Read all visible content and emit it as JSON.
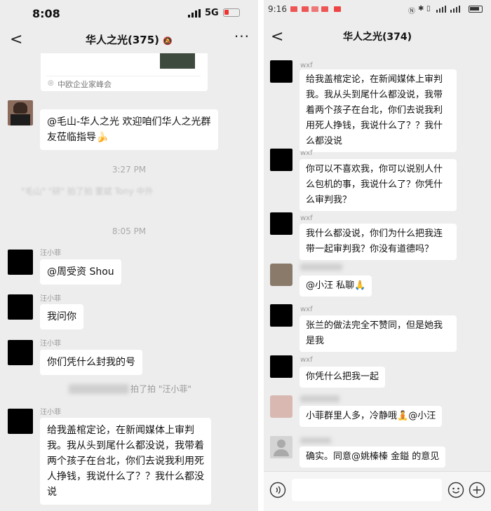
{
  "left": {
    "status": {
      "time": "8:08",
      "network": "5G"
    },
    "title": "华人之光(375)",
    "link_card_source": "中欧企业家峰会",
    "welcome_message": "@毛山-华人之光 欢迎咱们华人之光群友莅临指导",
    "welcome_emoji": "🍌",
    "time1": "3:27 PM",
    "blurred_line": "\"毛山\"  \"研\"   拍了拍 董斌 Tony 中外",
    "time2": "8:05 PM",
    "sender": "汪小菲",
    "msg1": "@周受资 Shou",
    "msg2": "我问你",
    "msg3": "你们凭什么封我的号",
    "pat_text": "拍了拍 \"汪小菲\"",
    "msg4": "给我盖棺定论，在新闻媒体上审判我。我从头到尾什么都没说，我带着两个孩子在台北，你们去说我利用死人挣钱，我说什么了？？我什么都没说"
  },
  "right": {
    "status": {
      "time": "9:16"
    },
    "title": "华人之光(374)",
    "sender": "wxf",
    "msg1": "给我盖棺定论，在新闻媒体上审判我。我从头到尾什么都没说，我带着两个孩子在台北，你们去说我利用死人挣钱，我说什么了？？我什么都没说",
    "msg2": "你可以不喜欢我，你可以说别人什么包机的事，我说什么了？你凭什么审判我？",
    "msg3": "我什么都没说，你们为什么把我连带一起审判我？你没有道德吗？",
    "msg4": "@小汪  私聊",
    "msg4_emoji": "🙏",
    "msg5": "张兰的做法完全不赞同，但是她我是我",
    "msg6": "你凭什么把我一起",
    "msg7": "小菲群里人多，冷静哦",
    "msg7_emoji": "🧘",
    "msg7_tail": "@小汪",
    "msg8": "确实。同意@姚榛榛 金鎰  的意见"
  }
}
